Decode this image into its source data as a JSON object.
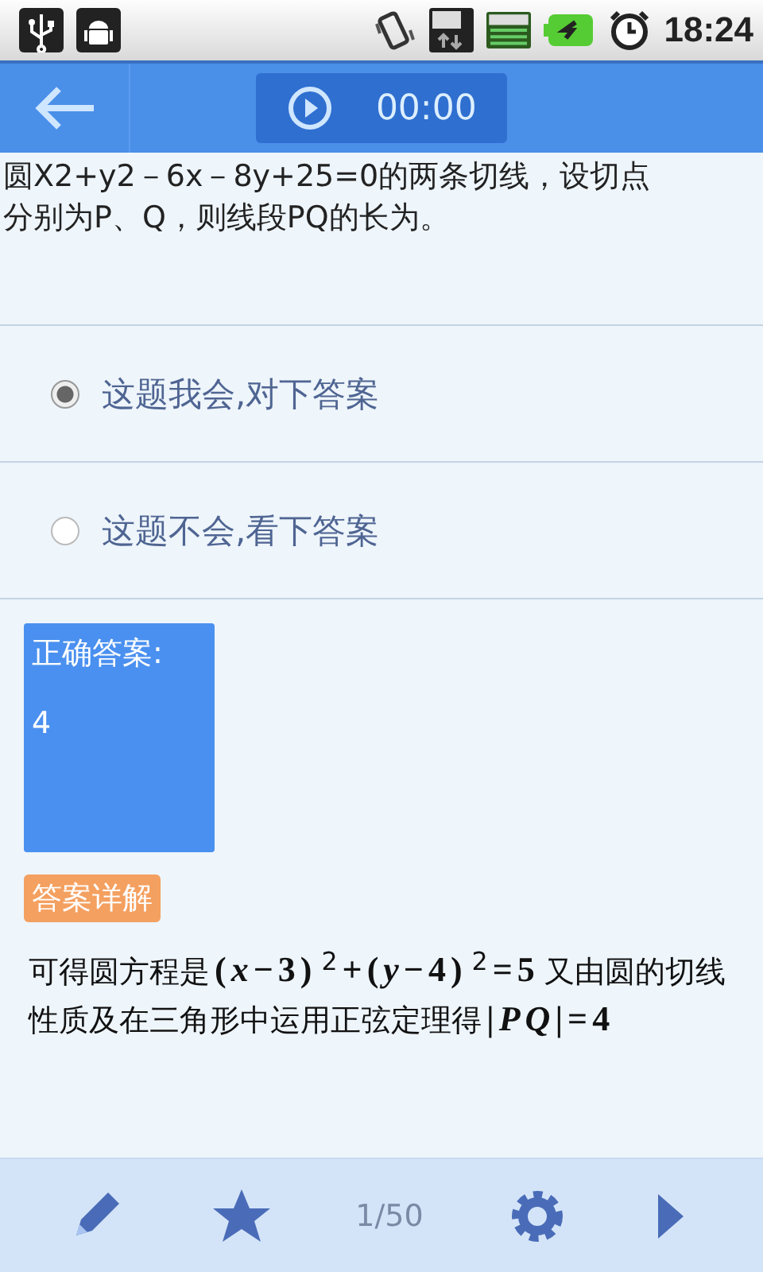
{
  "status_bar": {
    "time": "18:24"
  },
  "header": {
    "timer": "00:00"
  },
  "question": {
    "lines": [
      "圆X2+y2－6x－8y+25=0的两条切线，设切点",
      "分别为P、Q，则线段PQ的长为。"
    ]
  },
  "options": [
    {
      "label": "这题我会,对下答案",
      "selected": true
    },
    {
      "label": "这题不会,看下答案",
      "selected": false
    }
  ],
  "answer": {
    "title": "正确答案:",
    "value": "4"
  },
  "explanation": {
    "tag": "答案详解",
    "text": "可得圆方程是**(*x*−3)**$^{2}$**+(*y*−4)**$^{2}$**=5**又由圆的切线性质及在三角形中运用正弦定理得**|*PQ*|=4**"
  },
  "bottom_bar": {
    "page": "1/50"
  }
}
